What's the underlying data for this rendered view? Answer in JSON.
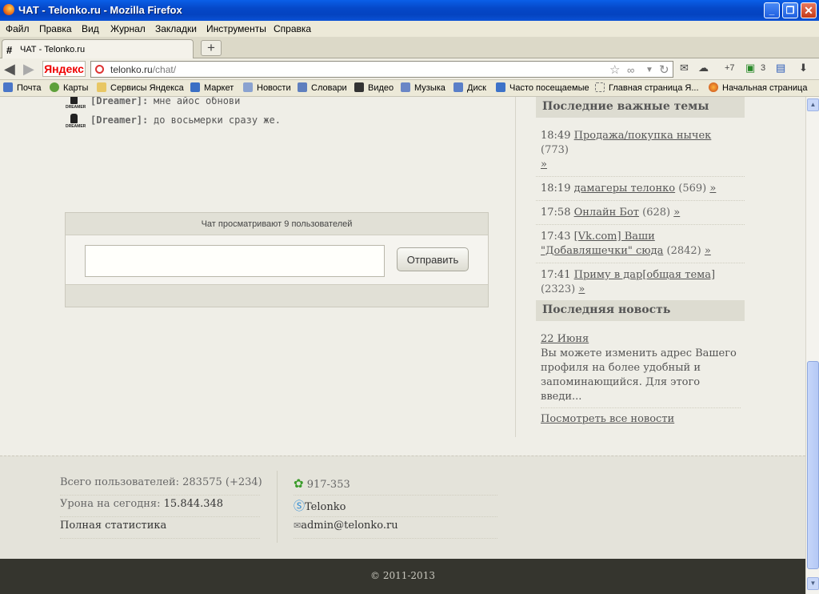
{
  "window": {
    "title": "ЧАТ - Telonko.ru - Mozilla Firefox"
  },
  "menu": [
    "Файл",
    "Правка",
    "Вид",
    "Журнал",
    "Закладки",
    "Инструменты",
    "Справка"
  ],
  "tab": {
    "title": "ЧАТ - Telonko.ru"
  },
  "nav": {
    "yandex_label": "Яндекс",
    "url_host": "telonko.ru",
    "url_path": "/chat/",
    "weather": "+7",
    "mail_count": "3"
  },
  "bookmarks": [
    "Почта",
    "Карты",
    "Сервисы Яндекса",
    "Маркет",
    "Новости",
    "Словари",
    "Видео",
    "Музыка",
    "Диск",
    "Часто посещаемые",
    "Главная страница Я...",
    "Начальная страница"
  ],
  "chat": {
    "messages": [
      {
        "nick": "[Dreamer]:",
        "text": "мне айос обнови",
        "avatar_caption": "DREAMER"
      },
      {
        "nick": "[Dreamer]:",
        "text": "до восьмерки сразу же.",
        "avatar_caption": "DREAMER"
      }
    ],
    "viewers_text": "Чат просматривают 9 пользователей",
    "send_label": "Отправить"
  },
  "important_topics": {
    "title": "Последние важные темы",
    "items": [
      {
        "time": "18:49",
        "title": "Продажа/покупка нычек",
        "count": "(773)"
      },
      {
        "time": "18:19",
        "title": "дамагеры телонко",
        "count": "(569)"
      },
      {
        "time": "17:58",
        "title": "Онлайн Бот",
        "count": "(628)"
      },
      {
        "time": "17:43",
        "title": "[Vk.com] Ваши \"Добавляшечки\" сюда",
        "count": "(2842)"
      },
      {
        "time": "17:41",
        "title": "Приму в дар[общая тема]",
        "count": "(2323)"
      }
    ],
    "more": "»"
  },
  "latest_news": {
    "title": "Последняя новость",
    "date": "22 Июня",
    "text": "Вы можете изменить адрес Вашего профиля на более удобный и запоминающийся. Для этого введи...",
    "all_link": "Посмотреть все новости"
  },
  "footer": {
    "users_label": "Всего пользователей:",
    "users_value": "283575 (+234)",
    "damage_label": "Урона на сегодня:",
    "damage_value": "15.844.348",
    "stats_link": "Полная статистика",
    "icq": "917-353",
    "skype": "Telonko",
    "email": "admin@telonko.ru",
    "copyright": "© 2011-2013"
  }
}
